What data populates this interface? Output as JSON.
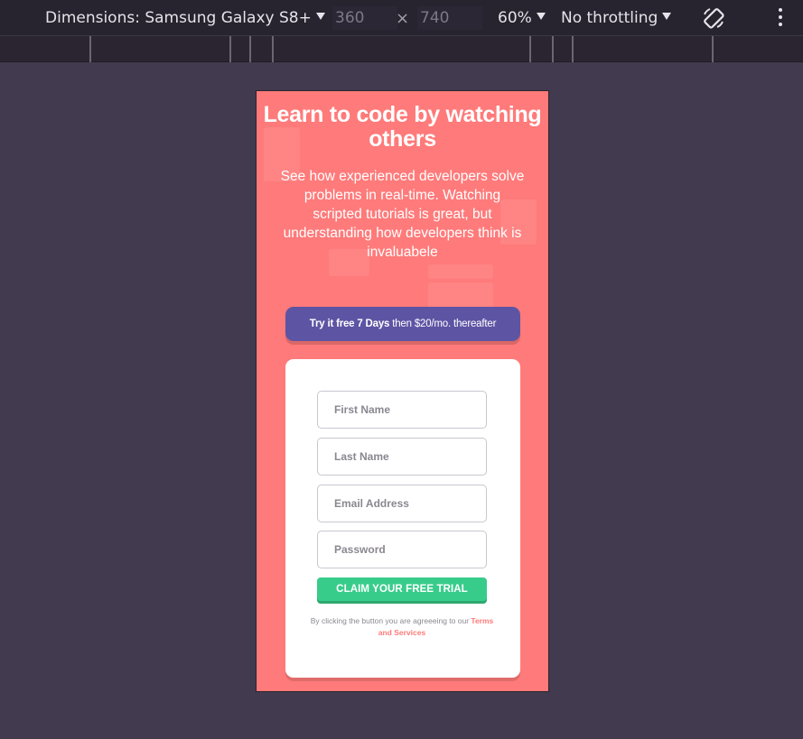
{
  "devtools": {
    "dimensions_label": "Dimensions: Samsung Galaxy S8+",
    "width": "360",
    "height": "740",
    "times": "×",
    "zoom": "60%",
    "throttling": "No throttling"
  },
  "hero": {
    "title": "Learn to code by watching others",
    "body": "See how experienced developers solve problems in real-time. Watching scripted tutorials is great, but understanding how developers think is invaluabele"
  },
  "promo": {
    "bold": "Try it free 7 Days",
    "rest": " then $20/mo. thereafter"
  },
  "form": {
    "first_name_placeholder": "First Name",
    "last_name_placeholder": "Last Name",
    "email_placeholder": "Email Address",
    "password_placeholder": "Password",
    "submit_label": "CLAIM YOUR FREE TRIAL",
    "terms_prefix": "By clicking the button you are agreeeing to our ",
    "terms_link": "Terms and Services"
  },
  "colors": {
    "page_bg": "#423a4e",
    "hero_bg": "#ff7a7a",
    "promo_bg": "#5d54a4",
    "cta_bg": "#38cc8b"
  }
}
